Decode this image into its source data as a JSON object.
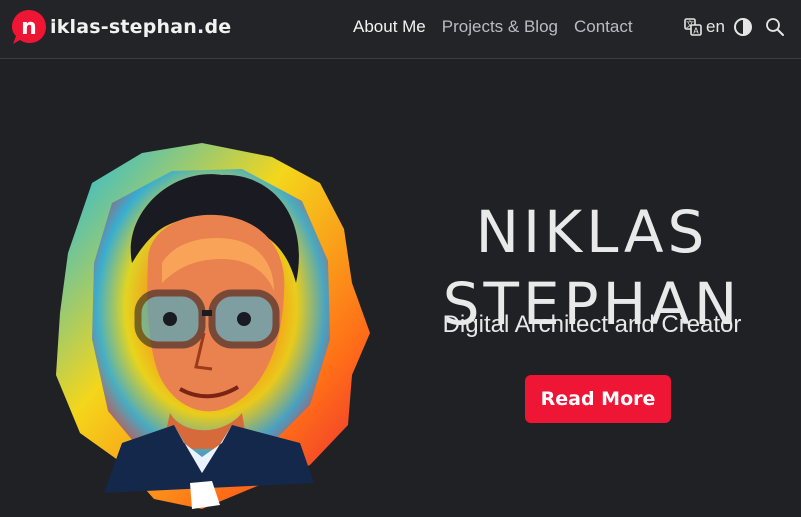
{
  "site": {
    "logo_letter": "n",
    "logo_text": "iklas-stephan.de"
  },
  "nav": {
    "items": [
      {
        "label": "About Me",
        "active": true
      },
      {
        "label": "Projects & Blog",
        "active": false
      },
      {
        "label": "Contact",
        "active": false
      }
    ]
  },
  "tools": {
    "translate_icon": "translate-icon",
    "language": "en",
    "theme_icon": "contrast-icon",
    "search_icon": "search-icon"
  },
  "hero": {
    "title_line1": "NIKLAS",
    "title_line2": "STEPHAN",
    "subtitle": "Digital Architect and Creator",
    "cta_label": "Read More",
    "portrait_icon": "portrait-illustration"
  },
  "colors": {
    "background": "#1f2124",
    "topbar": "#222427",
    "accent": "#ef1534",
    "text": "#e9e9ea",
    "nav_muted": "#b9bcc0"
  }
}
